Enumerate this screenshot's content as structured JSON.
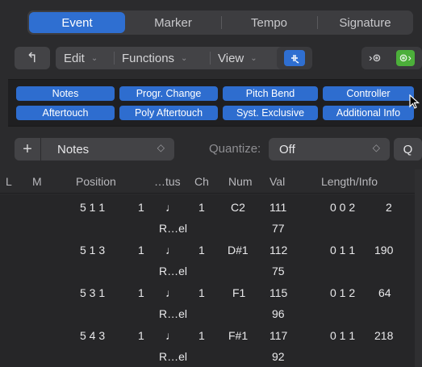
{
  "tabs": [
    {
      "label": "Event",
      "active": true
    },
    {
      "label": "Marker",
      "active": false
    },
    {
      "label": "Tempo",
      "active": false
    },
    {
      "label": "Signature",
      "active": false
    }
  ],
  "toolbar": {
    "up_icon": "↰",
    "edit_label": "Edit",
    "functions_label": "Functions",
    "view_label": "View",
    "chevron": "⌄",
    "midi_in_icon": "›⊛",
    "midi_out_icon": "⊛›"
  },
  "filters": {
    "row1": [
      "Notes",
      "Progr. Change",
      "Pitch Bend",
      "Controller"
    ],
    "row2": [
      "Aftertouch",
      "Poly Aftertouch",
      "Syst. Exclusive",
      "Additional Info"
    ]
  },
  "selbar": {
    "add_label": "+",
    "type_value": "Notes",
    "quantize_label": "Quantize:",
    "quantize_value": "Off",
    "q_label": "Q",
    "updown": "◇"
  },
  "columns": {
    "l": "L",
    "m": "M",
    "position": "Position",
    "status": "…tus",
    "ch": "Ch",
    "num": "Num",
    "val": "Val",
    "length": "Length/Info"
  },
  "events": [
    {
      "position": "5 1 1",
      "sub": "1",
      "status_icon": "♩",
      "ch": "1",
      "num": "C2",
      "val": "111",
      "length": "0 0 2",
      "length_tick": "2",
      "status_sub": "R…el",
      "val_sub": "77"
    },
    {
      "position": "5 1 3",
      "sub": "1",
      "status_icon": "♩",
      "ch": "1",
      "num": "D#1",
      "val": "112",
      "length": "0 1 1",
      "length_tick": "190",
      "status_sub": "R…el",
      "val_sub": "75"
    },
    {
      "position": "5 3 1",
      "sub": "1",
      "status_icon": "♩",
      "ch": "1",
      "num": "F1",
      "val": "115",
      "length": "0 1 2",
      "length_tick": "64",
      "status_sub": "R…el",
      "val_sub": "96"
    },
    {
      "position": "5 4 3",
      "sub": "1",
      "status_icon": "♩",
      "ch": "1",
      "num": "F#1",
      "val": "117",
      "length": "0 1 1",
      "length_tick": "218",
      "status_sub": "R…el",
      "val_sub": "92"
    }
  ],
  "colors": {
    "accent": "#2f6fd1",
    "midi_out": "#4caf3a"
  }
}
